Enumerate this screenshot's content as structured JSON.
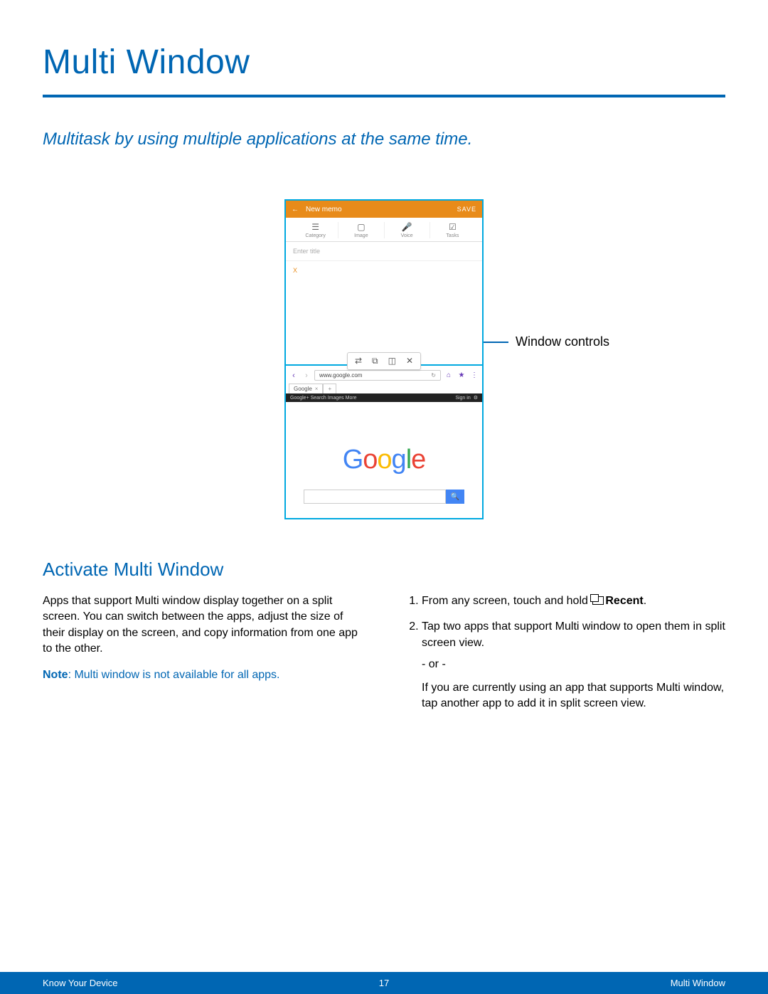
{
  "page": {
    "title": "Multi Window",
    "intro": "Multitask by using multiple applications at the same time."
  },
  "callout": {
    "label": "Window controls"
  },
  "memo": {
    "header_title": "New memo",
    "save": "SAVE",
    "tools": {
      "category": "Category",
      "image": "Image",
      "voice": "Voice",
      "tasks": "Tasks"
    },
    "entry_placeholder": "Enter title",
    "content": "X"
  },
  "browser": {
    "url": "www.google.com",
    "tab_label": "Google",
    "blackbar_left": "Google+  Search  Images  More",
    "blackbar_signin": "Sign in"
  },
  "google": {
    "logo_text": "Google"
  },
  "section": {
    "heading": "Activate Multi Window",
    "body": "Apps that support Multi window display together on a split screen. You can switch between the apps, adjust the size of their display on the screen, and copy information from one app to the other.",
    "note_label": "Note",
    "note_text": ": Multi window is not available for all apps."
  },
  "steps": {
    "s1a": "From any screen, touch and hold ",
    "s1b": "Recent",
    "s1c": ".",
    "s2": "Tap two apps that support Multi window to open them in split screen view.",
    "or": "- or -",
    "s2b": "If you are currently using an app that supports Multi window, tap another app to add it in split screen view."
  },
  "footer": {
    "left": "Know Your Device",
    "page": "17",
    "right": "Multi Window"
  }
}
